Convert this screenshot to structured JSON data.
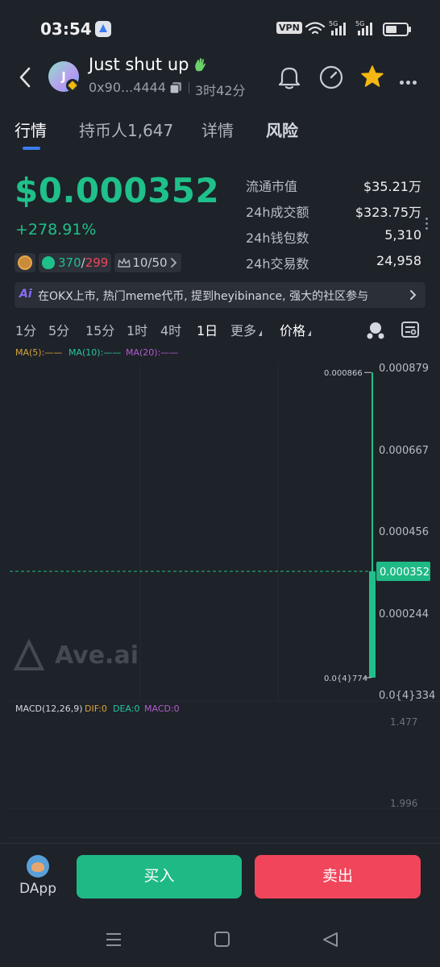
{
  "status_bar": {
    "time": "03:54",
    "vpn": "VPN",
    "signal_1": "5G",
    "signal_2": "5G"
  },
  "header": {
    "avatar_letter": "J",
    "token_name": "Just shut up",
    "address": "0x90...4444",
    "age": "3时42分"
  },
  "tabs": [
    "行情",
    "持币人1,647",
    "详情",
    "风险"
  ],
  "price": {
    "value": "$0.000352",
    "change": "+278.91%"
  },
  "stats": {
    "buy_count": "370",
    "slash": "/",
    "sell_count": "299",
    "rank": "10/50"
  },
  "metrics": [
    {
      "label": "流通市值",
      "value": "$35.21万"
    },
    {
      "label": "24h成交额",
      "value": "$323.75万"
    },
    {
      "label": "24h钱包数",
      "value": "5,310"
    },
    {
      "label": "24h交易数",
      "value": "24,958"
    }
  ],
  "ai_bar": {
    "tag": "Ai",
    "text": "在OKX上市, 热门meme代币, 提到heyibinance, 强大的社区参与"
  },
  "intervals": [
    "1分",
    "5分",
    "15分",
    "1时",
    "4时",
    "1日",
    "更多",
    "价格"
  ],
  "active_interval": "1日",
  "chart_data": {
    "type": "candlestick",
    "ma_legend": [
      "MA(5):——",
      "MA(10):——",
      "MA(20):——"
    ],
    "ma_colors": [
      "#d9a53b",
      "#26c6a0",
      "#b05ccf"
    ],
    "y_ticks": [
      "0.000879",
      "0.000667",
      "0.000456",
      "0.000244",
      "0.0{4}334"
    ],
    "y_tick_values": [
      0.000879,
      0.000667,
      0.000456,
      0.000244,
      3.34e-05
    ],
    "current_price_label": "0.000352",
    "current_price": 0.000352,
    "high_label": "0.000866",
    "low_label": "0.0{4}774",
    "candles": [
      {
        "open": 7.74e-05,
        "close": 0.000352,
        "high": 0.000866,
        "low": 7.74e-05
      }
    ],
    "watermark": "Ave.ai",
    "macd_legend": {
      "title": "MACD(12,26,9)",
      "dif": "DIF:0",
      "dea": "DEA:0",
      "macd": "MACD:0"
    },
    "macd_ticks": [
      "1.477",
      "1.996"
    ]
  },
  "bottom": {
    "dapp": "DApp",
    "buy": "买入",
    "sell": "卖出"
  },
  "colors": {
    "up": "#1fc08a",
    "down": "#f0455a",
    "accent": "#3b7cf0",
    "background": "#1e2229"
  }
}
